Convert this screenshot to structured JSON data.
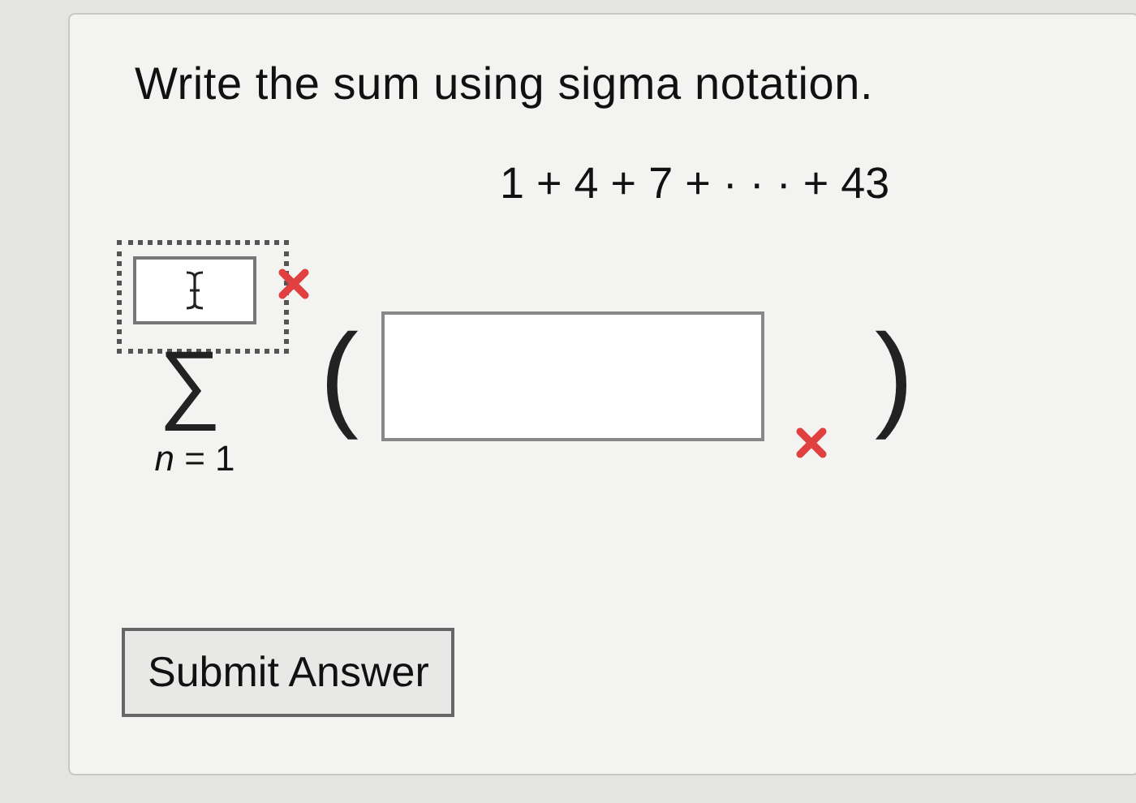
{
  "question": {
    "prompt": "Write the sum using sigma notation.",
    "expression": "1 + 4 + 7 + · · · + 43"
  },
  "sigma": {
    "symbol": "∑",
    "lower_limit": "*n* = 1",
    "upper_field": {
      "focused": true,
      "incorrect": true
    }
  },
  "term": {
    "open_paren": "(",
    "close_paren": ")",
    "field": {
      "focused": false,
      "incorrect": true
    }
  },
  "submit": {
    "label": "Submit Answer"
  }
}
